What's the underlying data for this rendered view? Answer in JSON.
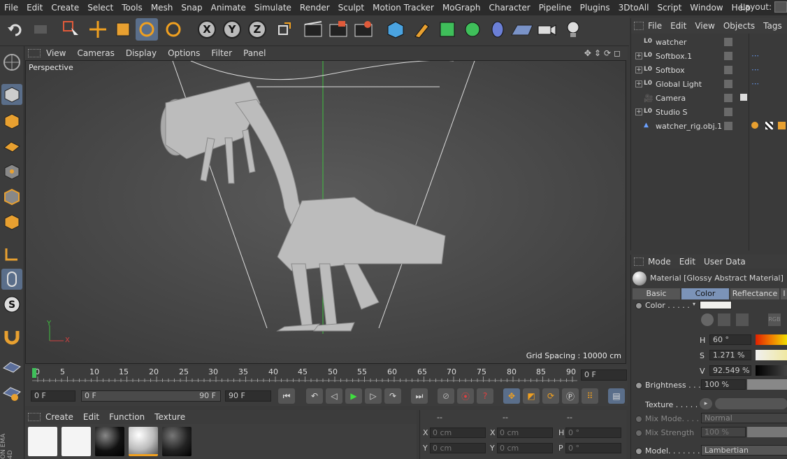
{
  "menubar": {
    "items": [
      "File",
      "Edit",
      "Create",
      "Select",
      "Tools",
      "Mesh",
      "Snap",
      "Animate",
      "Simulate",
      "Render",
      "Sculpt",
      "Motion Tracker",
      "MoGraph",
      "Character",
      "Pipeline",
      "Plugins",
      "3DtoAll",
      "Script",
      "Window",
      "Help"
    ],
    "layout_label": "Layout:"
  },
  "toolbar": {
    "axis_x": "X",
    "axis_y": "Y",
    "axis_z": "Z"
  },
  "viewport": {
    "menu": [
      "View",
      "Cameras",
      "Display",
      "Options",
      "Filter",
      "Panel"
    ],
    "label": "Perspective",
    "grid_spacing": "Grid Spacing : 10000 cm",
    "axis_y": "Y",
    "axis_x": "X"
  },
  "timeline": {
    "ticks": [
      "0",
      "5",
      "10",
      "15",
      "20",
      "25",
      "30",
      "35",
      "40",
      "45",
      "50",
      "55",
      "60",
      "65",
      "70",
      "75",
      "80",
      "85",
      "90"
    ],
    "current_frame": "0 F",
    "start_frame": "0 F",
    "range_start": "0 F",
    "range_end": "90 F",
    "end_frame": "90 F"
  },
  "material_manager": {
    "menu": [
      "Create",
      "Edit",
      "Function",
      "Texture"
    ]
  },
  "coordinates": {
    "headers": [
      "--",
      "--",
      "--"
    ],
    "rows": [
      {
        "l1": "X",
        "v1": "0 cm",
        "l2": "X",
        "v2": "0 cm",
        "l3": "H",
        "v3": "0 °"
      },
      {
        "l1": "Y",
        "v1": "0 cm",
        "l2": "Y",
        "v2": "0 cm",
        "l3": "P",
        "v3": "0 °"
      }
    ]
  },
  "object_manager": {
    "menu": [
      "File",
      "Edit",
      "View",
      "Objects",
      "Tags"
    ],
    "objects": [
      {
        "name": "watcher",
        "icon": "L0",
        "expand": ""
      },
      {
        "name": "Softbox.1",
        "icon": "L0",
        "expand": "+"
      },
      {
        "name": "Softbox",
        "icon": "L0",
        "expand": "+"
      },
      {
        "name": "Global Light",
        "icon": "L0",
        "expand": "+"
      },
      {
        "name": "Camera",
        "icon": "cam",
        "expand": ""
      },
      {
        "name": "Studio S",
        "icon": "L0",
        "expand": "+"
      },
      {
        "name": "watcher_rig.obj.1",
        "icon": "tri",
        "expand": ""
      }
    ]
  },
  "attributes": {
    "menu": [
      "Mode",
      "Edit",
      "User Data"
    ],
    "title": "Material [Glossy Abstract Material]",
    "tabs": [
      "Basic",
      "Color",
      "Reflectance"
    ],
    "color_label": "Color . . . . .",
    "h_label": "H",
    "h_value": "60 °",
    "s_label": "S",
    "s_value": "1.271 %",
    "v_label": "V",
    "v_value": "92.549 %",
    "brightness_label": "Brightness . . .",
    "brightness_value": "100 %",
    "texture_label": "Texture . . . . .",
    "mixmode_label": "Mix Mode. . . .",
    "mixmode_value": "Normal",
    "mixstrength_label": "Mix Strength",
    "mixstrength_value": "100 %",
    "model_label": "Model. . . . . . .",
    "model_value": "Lambertian"
  },
  "side_brand": "ON\nEMA 4D"
}
